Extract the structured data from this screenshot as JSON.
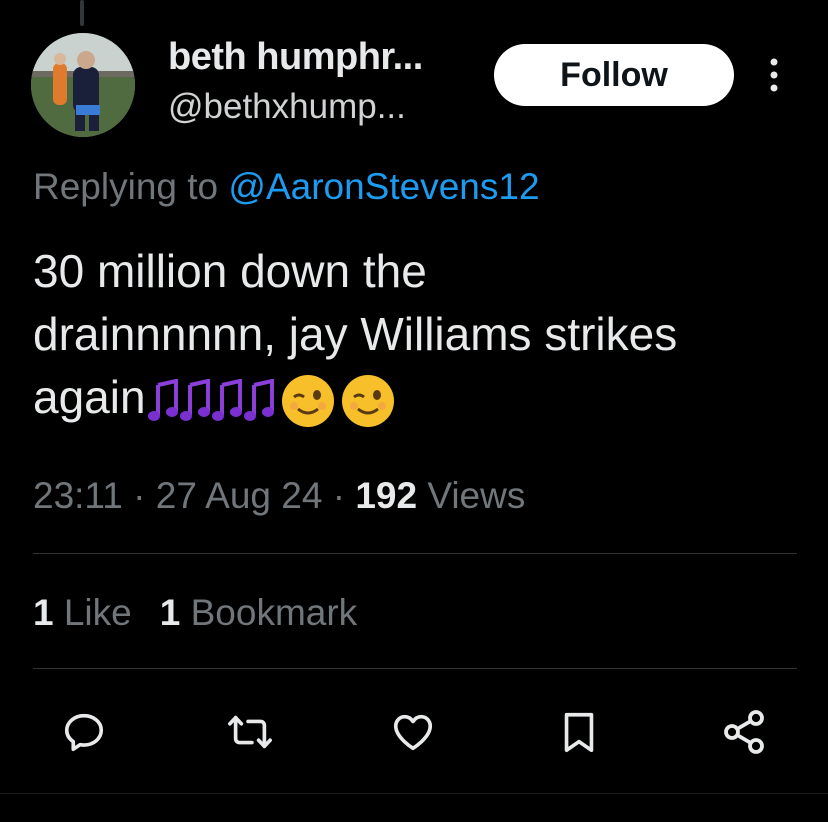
{
  "tweet": {
    "display_name": "beth humphr...",
    "handle": "@bethxhump...",
    "follow_label": "Follow",
    "replying_prefix": "Replying to ",
    "replying_to": "@AaronStevens12",
    "text_line1": "30 million down the",
    "text_line2": "drainnnnnn, jay Williams strikes",
    "text_line3": "again",
    "emoji": [
      "musical-notes",
      "musical-notes",
      "musical-notes",
      "musical-notes",
      "winking-face",
      "winking-face"
    ],
    "time": "23:11",
    "date": "27 Aug 24",
    "views_count": "192",
    "views_label": "Views",
    "likes_count": "1",
    "likes_label": "Like",
    "bookmarks_count": "1",
    "bookmarks_label": "Bookmark"
  },
  "icons": {
    "more": "more-vertical-icon",
    "reply": "reply-icon",
    "retweet": "retweet-icon",
    "like": "heart-icon",
    "bookmark": "bookmark-icon",
    "share": "share-icon"
  },
  "colors": {
    "background": "#000000",
    "text": "#e7e9ea",
    "secondary": "#71767b",
    "link": "#1d9bf0",
    "divider": "#2f3336"
  }
}
